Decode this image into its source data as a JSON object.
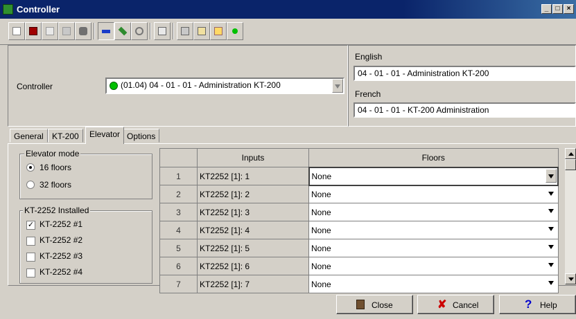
{
  "window": {
    "title": "Controller"
  },
  "controller": {
    "label": "Controller",
    "selected": "(01.04) 04 - 01 - 01 - Administration KT-200"
  },
  "names": {
    "english_label": "English",
    "english_value": "04 - 01 - 01 - Administration KT-200",
    "french_label": "French",
    "french_value": "04 - 01 - 01 -  KT-200 Administration"
  },
  "tabs": [
    "General",
    "KT-200",
    "Elevator",
    "Options"
  ],
  "elevator_mode": {
    "title": "Elevator mode",
    "opt16": "16 floors",
    "opt32": "32 floors",
    "selected": "16 floors"
  },
  "kt2252": {
    "title": "KT-2252 Installed",
    "items": [
      "KT-2252 #1",
      "KT-2252 #2",
      "KT-2252 #3",
      "KT-2252 #4"
    ],
    "checked": [
      true,
      false,
      false,
      false
    ]
  },
  "grid": {
    "headers": [
      "Inputs",
      "Floors"
    ],
    "rows": [
      {
        "n": "1",
        "input": "KT2252 [1]: 1",
        "floor": "None"
      },
      {
        "n": "2",
        "input": "KT2252 [1]: 2",
        "floor": "None"
      },
      {
        "n": "3",
        "input": "KT2252 [1]: 3",
        "floor": "None"
      },
      {
        "n": "4",
        "input": "KT2252 [1]: 4",
        "floor": "None"
      },
      {
        "n": "5",
        "input": "KT2252 [1]: 5",
        "floor": "None"
      },
      {
        "n": "6",
        "input": "KT2252 [1]: 6",
        "floor": "None"
      },
      {
        "n": "7",
        "input": "KT2252 [1]: 7",
        "floor": "None"
      }
    ]
  },
  "buttons": {
    "close": "Close",
    "cancel": "Cancel",
    "help": "Help"
  },
  "colors": {
    "title_bar": "#0a246a",
    "status_green": "#00c000",
    "cancel_x": "#cc0000",
    "help_q": "#0000cc"
  }
}
